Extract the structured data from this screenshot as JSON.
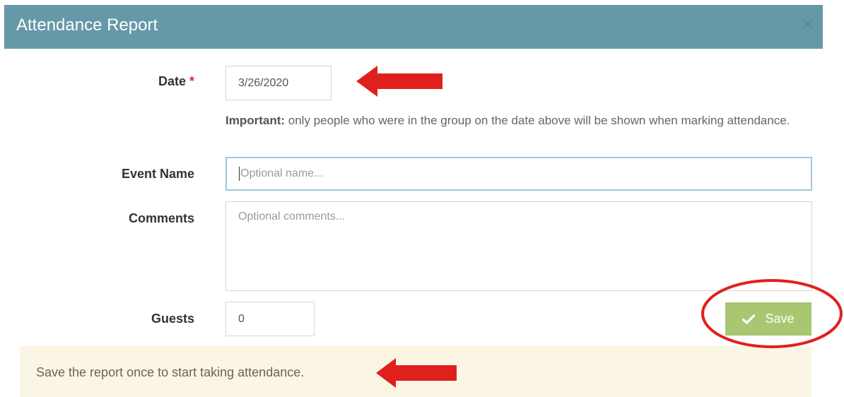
{
  "dialog": {
    "title": "Attendance Report",
    "close_icon": "close-icon"
  },
  "form": {
    "date": {
      "label": "Date",
      "required_mark": "*",
      "value": "3/26/2020"
    },
    "note": {
      "strong": "Important:",
      "text": " only people who were in the group on the date above will be shown when marking attendance."
    },
    "event_name": {
      "label": "Event Name",
      "placeholder": "Optional name..."
    },
    "comments": {
      "label": "Comments",
      "placeholder": "Optional comments..."
    },
    "guests": {
      "label": "Guests",
      "value": "0"
    },
    "save_button": {
      "label": "Save",
      "icon": "check-icon"
    }
  },
  "alert": {
    "text": "Save the report once to start taking attendance."
  },
  "annotations": {
    "arrow_color": "#e0201c",
    "circle_color": "#e0201c"
  },
  "colors": {
    "header_bg": "#6599a8",
    "save_bg": "#a9c771",
    "alert_bg": "#fbf5e3",
    "required": "#d9302c"
  }
}
